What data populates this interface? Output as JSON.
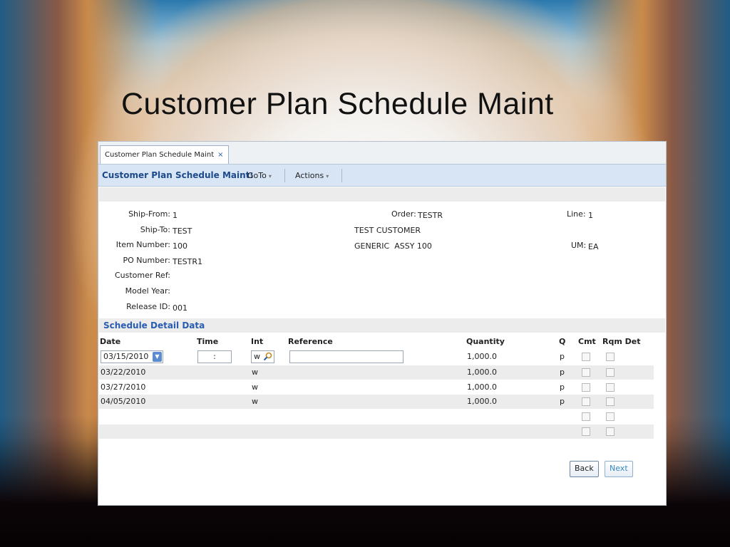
{
  "slide": {
    "title": "Customer Plan Schedule Maint"
  },
  "tab": {
    "label": "Customer Plan Schedule Maint",
    "close": "×"
  },
  "toolbar": {
    "title": "Customer Plan Schedule Maint:",
    "goto": "GoTo",
    "actions": "Actions"
  },
  "header": {
    "ship_from_label": "Ship-From:",
    "ship_from": "1",
    "ship_to_label": "Ship-To:",
    "ship_to": "TEST",
    "item_number_label": "Item Number:",
    "item_number": "100",
    "po_number_label": "PO Number:",
    "po_number": "TESTR1",
    "customer_ref_label": "Customer Ref:",
    "customer_ref": "",
    "model_year_label": "Model Year:",
    "model_year": "",
    "release_id_label": "Release ID:",
    "release_id": "001",
    "order_label": "Order:",
    "order": "TESTR",
    "customer_name": "TEST CUSTOMER",
    "item_desc": "GENERIC  ASSY 100",
    "line_label": "Line:",
    "line": "1",
    "um_label": "UM:",
    "um": "EA"
  },
  "schedule": {
    "section_title": "Schedule Detail Data",
    "columns": {
      "date": "Date",
      "time": "Time",
      "int": "Int",
      "reference": "Reference",
      "quantity": "Quantity",
      "q": "Q",
      "cmt": "Cmt",
      "rqm_det": "Rqm Det"
    },
    "edit_row": {
      "date": "03/15/2010",
      "time": " : ",
      "int": "w",
      "reference": "",
      "quantity": "1,000.0",
      "q": "p"
    },
    "rows": [
      {
        "date": "03/22/2010",
        "int": "w",
        "quantity": "1,000.0",
        "q": "p"
      },
      {
        "date": "03/27/2010",
        "int": "w",
        "quantity": "1,000.0",
        "q": "p"
      },
      {
        "date": "04/05/2010",
        "int": "w",
        "quantity": "1,000.0",
        "q": "p"
      }
    ]
  },
  "buttons": {
    "back": "Back",
    "next": "Next"
  }
}
